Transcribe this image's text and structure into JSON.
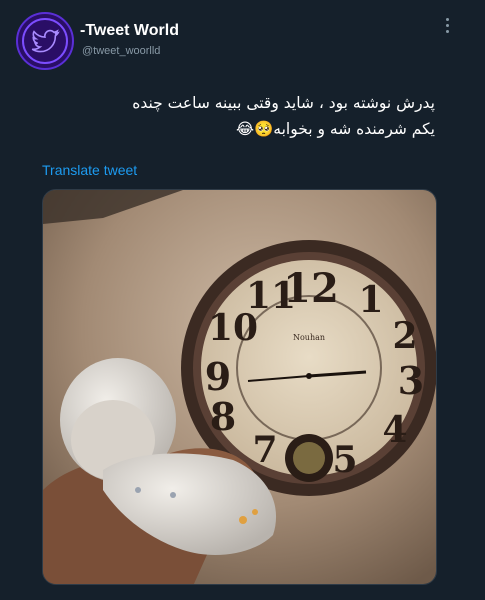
{
  "header": {
    "display_name": "-Tweet World",
    "handle": "@tweet_woorlld",
    "avatar_icon": "twitter-bird-logo",
    "more_icon": "vertical-ellipsis-icon"
  },
  "tweet": {
    "line1": "پدرش نوشته بود ، شاید وقتی ببینه ساعت چنده",
    "line2": "یکم شرمنده شه و بخوابه🥺😂",
    "translate_label": "Translate tweet"
  },
  "media": {
    "clock_brand": "Nouhan",
    "clock_numbers": [
      "12",
      "1",
      "2",
      "3",
      "4",
      "5",
      "7",
      "8",
      "9",
      "10",
      "11"
    ]
  },
  "colors": {
    "background": "#15202b",
    "link": "#1d9bf0",
    "secondary_text": "#8899a6",
    "avatar_bg": "#2a0e66",
    "avatar_accent": "#7c4dff"
  }
}
